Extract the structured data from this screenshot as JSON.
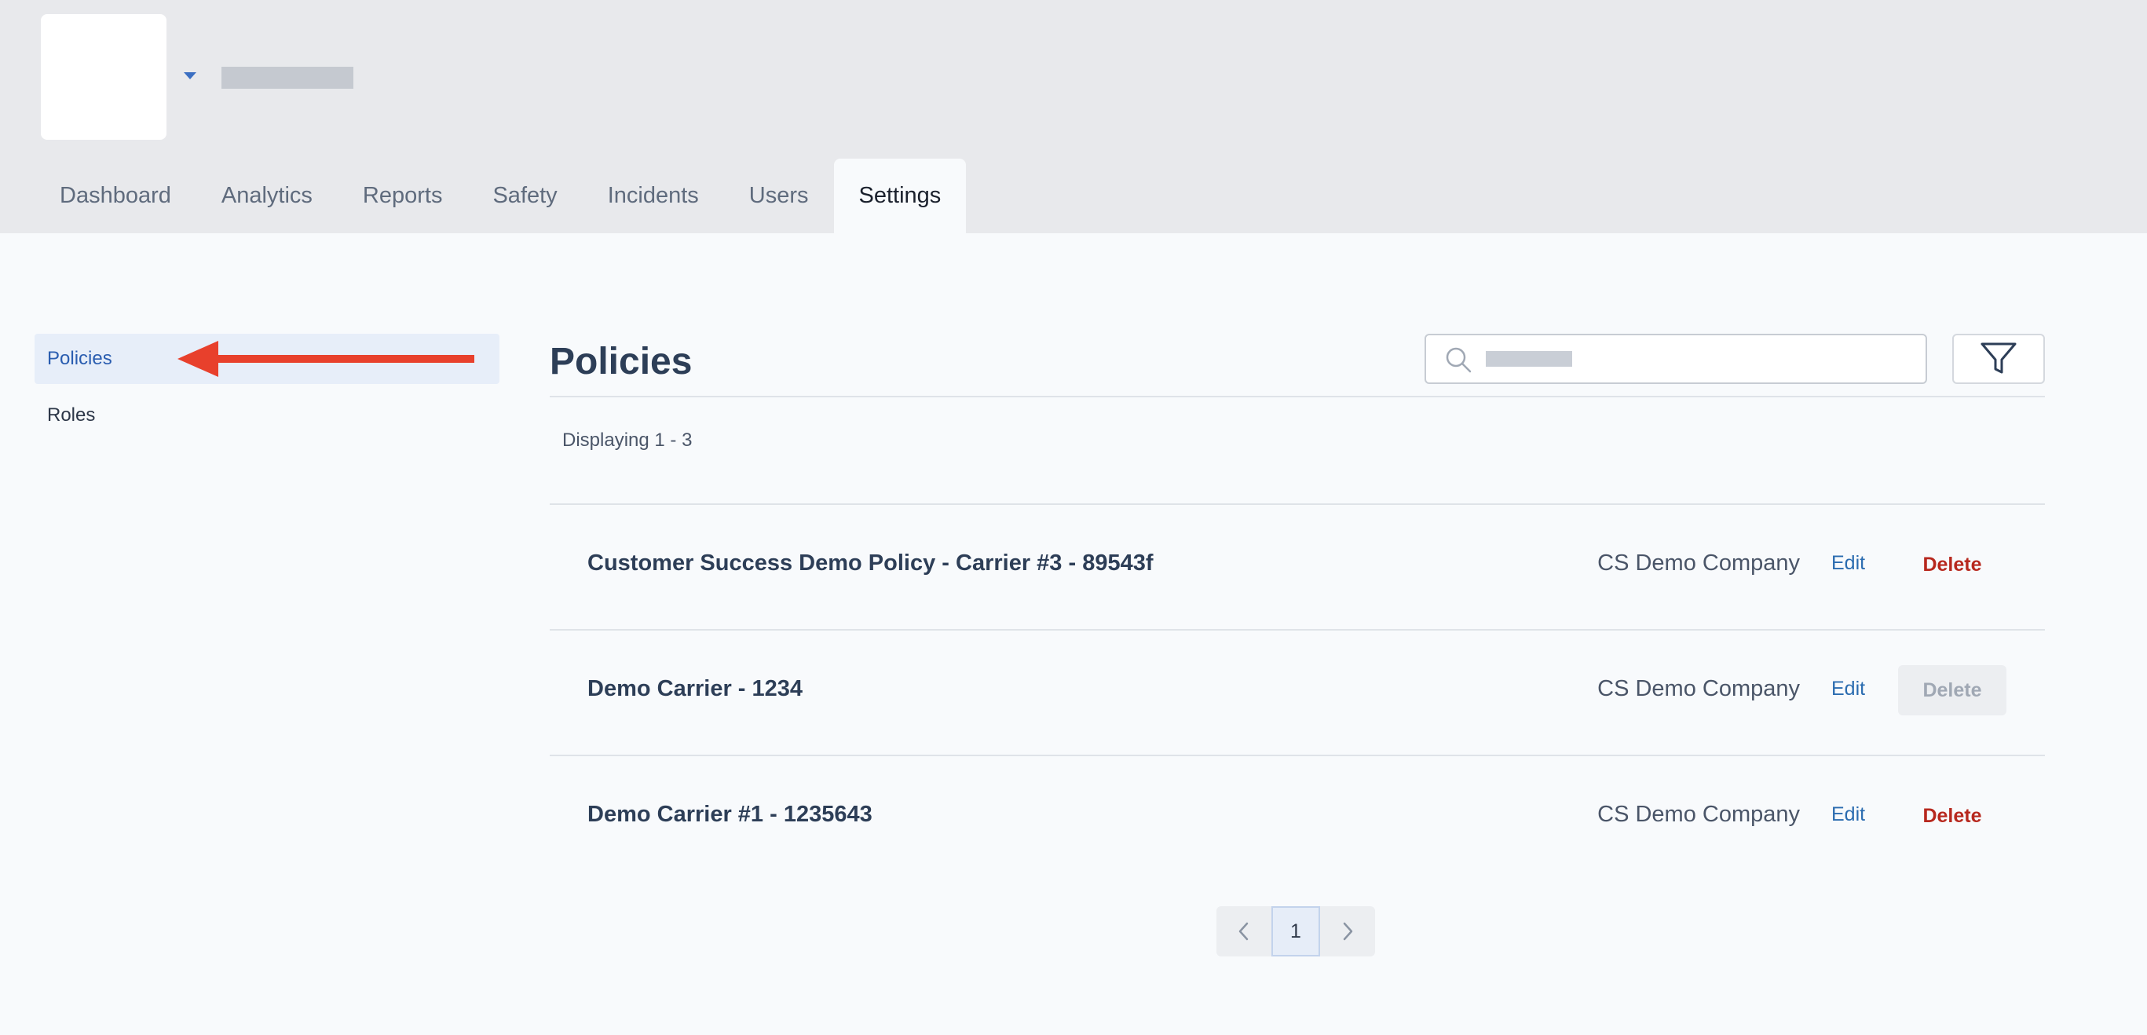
{
  "nav": {
    "tabs": [
      {
        "label": "Dashboard"
      },
      {
        "label": "Analytics"
      },
      {
        "label": "Reports"
      },
      {
        "label": "Safety"
      },
      {
        "label": "Incidents"
      },
      {
        "label": "Users"
      },
      {
        "label": "Settings",
        "active": true
      }
    ]
  },
  "sidebar": {
    "items": [
      {
        "label": "Policies",
        "active": true
      },
      {
        "label": "Roles"
      }
    ]
  },
  "main": {
    "title": "Policies",
    "search": {
      "value": "",
      "placeholder": ""
    },
    "displaying": "Displaying 1 - 3",
    "policies": [
      {
        "name": "Customer Success Demo Policy - Carrier #3 - 89543f",
        "company": "CS Demo Company",
        "edit_label": "Edit",
        "delete_label": "Delete",
        "delete_disabled": false
      },
      {
        "name": "Demo Carrier - 1234",
        "company": "CS Demo Company",
        "edit_label": "Edit",
        "delete_label": "Delete",
        "delete_disabled": true
      },
      {
        "name": "Demo Carrier #1 - 1235643",
        "company": "CS Demo Company",
        "edit_label": "Edit",
        "delete_label": "Delete",
        "delete_disabled": false
      }
    ],
    "pagination": {
      "current_page": "1"
    }
  },
  "colors": {
    "header_bg": "#e8e9ec",
    "accent": "#2b6cb0",
    "danger": "#b7281e",
    "arrow": "#e8402c"
  },
  "icons": {
    "org_menu": "caret-down-icon",
    "search": "search-icon",
    "filter": "filter-icon",
    "prev": "chevron-left-icon",
    "next": "chevron-right-icon",
    "annotation": "arrow-left-icon"
  }
}
